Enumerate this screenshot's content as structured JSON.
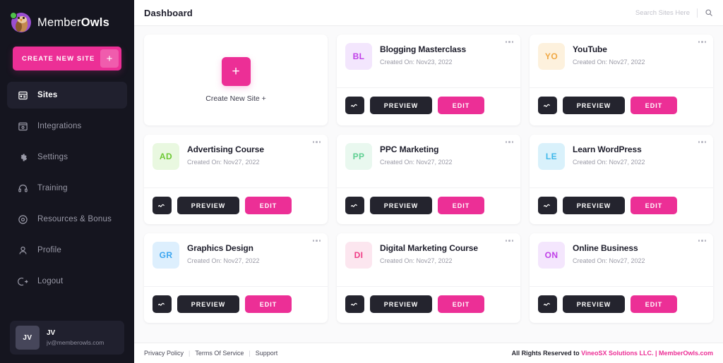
{
  "brand": {
    "name_light": "Member",
    "name_bold": "Owls",
    "logo_icon": "owl-logo-icon"
  },
  "sidebar": {
    "create_button": {
      "label": "CREATE NEW SITE",
      "plus": "+"
    },
    "items": [
      {
        "label": "Sites",
        "icon": "sites-icon",
        "active": true
      },
      {
        "label": "Integrations",
        "icon": "integrations-icon",
        "active": false
      },
      {
        "label": "Settings",
        "icon": "gear-icon",
        "active": false
      },
      {
        "label": "Training",
        "icon": "headset-icon",
        "active": false
      },
      {
        "label": "Resources & Bonus",
        "icon": "disc-icon",
        "active": false
      },
      {
        "label": "Profile",
        "icon": "user-icon",
        "active": false
      },
      {
        "label": "Logout",
        "icon": "logout-icon",
        "active": false
      }
    ],
    "user": {
      "initials": "JV",
      "name": "JV",
      "email": "jv@memberowls.com"
    }
  },
  "topbar": {
    "title": "Dashboard",
    "search": {
      "value": "",
      "placeholder": "Search Sites Here",
      "icon": "search-icon"
    }
  },
  "new_site_card": {
    "plus": "+",
    "label": "Create New Site +"
  },
  "card_actions": {
    "stat_icon": "analytics-wave-icon",
    "preview_label": "PREVIEW",
    "edit_label": "EDIT",
    "menu_icon": "more-options-icon"
  },
  "sites": [
    {
      "initials": "BL",
      "name": "Blogging Masterclass",
      "created": "Created On: Nov23, 2022",
      "bg": "#f3e6fd",
      "fg": "#c040e8"
    },
    {
      "initials": "YO",
      "name": "YouTube",
      "created": "Created On: Nov27, 2022",
      "bg": "#fdf1dd",
      "fg": "#f0a843"
    },
    {
      "initials": "AD",
      "name": "Advertising Course",
      "created": "Created On: Nov27, 2022",
      "bg": "#e9f8e0",
      "fg": "#6cc832"
    },
    {
      "initials": "PP",
      "name": "PPC Marketing",
      "created": "Created On: Nov27, 2022",
      "bg": "#e9f8ef",
      "fg": "#5fcf92"
    },
    {
      "initials": "LE",
      "name": "Learn WordPress",
      "created": "Created On: Nov27, 2022",
      "bg": "#d9f1fb",
      "fg": "#3fb8ea"
    },
    {
      "initials": "GR",
      "name": "Graphics Design",
      "created": "Created On: Nov27, 2022",
      "bg": "#ddeffd",
      "fg": "#3aa5f0"
    },
    {
      "initials": "DI",
      "name": "Digital Marketing Course",
      "created": "Created On: Nov27, 2022",
      "bg": "#fce6ef",
      "fg": "#ef3d86"
    },
    {
      "initials": "ON",
      "name": "Online Business",
      "created": "Created On: Nov27, 2022",
      "bg": "#f4e6fd",
      "fg": "#c040e8"
    }
  ],
  "footer": {
    "links": [
      "Privacy Policy",
      "Terms Of Service",
      "Support"
    ],
    "separator": "|",
    "rights_prefix": "All Rights Reserved to ",
    "rights_pink": "VineoSX Solutions LLC. | MemberOwls.com"
  },
  "colors": {
    "accent": "#ec2f96",
    "sidebar": "#15151f",
    "dark_button": "#24242e"
  }
}
